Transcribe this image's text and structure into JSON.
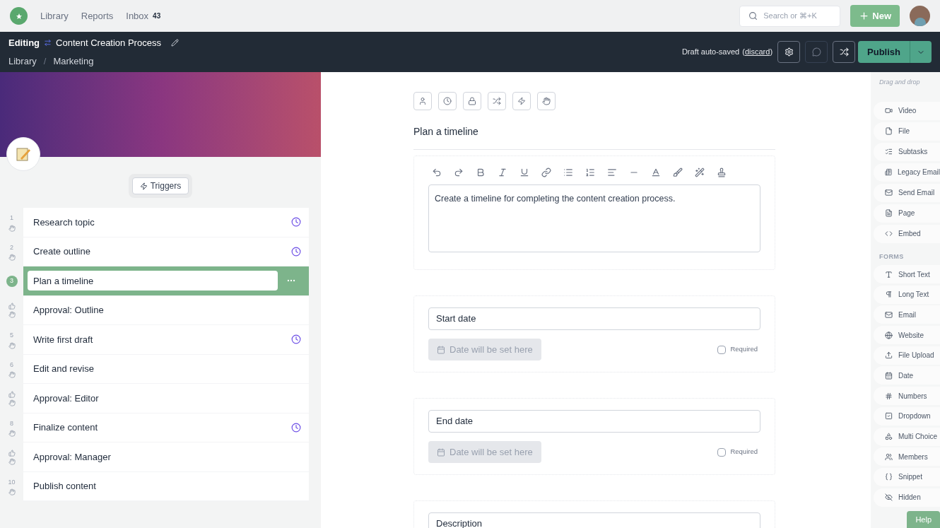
{
  "nav": {
    "links": [
      "Library",
      "Reports",
      "Inbox"
    ],
    "inbox_count": "43",
    "search": {
      "placeholder": "Search or ⌘+K"
    },
    "new_button": "New"
  },
  "header": {
    "mode": "Editing",
    "title": "Content Creation Process",
    "breadcrumb": [
      "Library",
      "Marketing"
    ],
    "breadcrumb_separator": "/",
    "draft_status": "Draft auto-saved",
    "discard_open": "(",
    "discard": "discard",
    "discard_close": ")",
    "publish": "Publish"
  },
  "triggers": "Triggers",
  "steps": [
    {
      "marker": "1",
      "kind": "task",
      "title": "Research topic",
      "timed": true,
      "selected": false
    },
    {
      "marker": "2",
      "kind": "task",
      "title": "Create outline",
      "timed": true,
      "selected": false
    },
    {
      "marker": "3",
      "kind": "task",
      "title": "Plan a timeline",
      "timed": false,
      "selected": true
    },
    {
      "kind": "approval",
      "title": "Approval: Outline",
      "timed": false,
      "selected": false
    },
    {
      "marker": "5",
      "kind": "task",
      "title": "Write first draft",
      "timed": true,
      "selected": false
    },
    {
      "marker": "6",
      "kind": "task",
      "title": "Edit and revise",
      "timed": false,
      "selected": false
    },
    {
      "kind": "approval",
      "title": "Approval: Editor",
      "timed": false,
      "selected": false
    },
    {
      "marker": "8",
      "kind": "task",
      "title": "Finalize content",
      "timed": true,
      "selected": false
    },
    {
      "kind": "approval",
      "title": "Approval: Manager",
      "timed": false,
      "selected": false
    },
    {
      "marker": "10",
      "kind": "task",
      "title": "Publish content",
      "timed": false,
      "selected": false
    }
  ],
  "editor": {
    "title": "Plan a timeline",
    "text": "Create a timeline for completing the content creation process.",
    "fields": [
      {
        "kind": "date",
        "label": "Start date",
        "button": "Date will be set here",
        "required_label": "Required",
        "required": false
      },
      {
        "kind": "date",
        "label": "End date",
        "button": "Date will be set here",
        "required_label": "Required",
        "required": false
      },
      {
        "kind": "text",
        "label": "Description"
      }
    ]
  },
  "widgets": {
    "hint": "Drag and drop",
    "content": [
      "Video",
      "File",
      "Subtasks",
      "Legacy Email",
      "Send Email",
      "Page",
      "Embed"
    ],
    "forms_heading": "FORMS",
    "forms": [
      "Short Text",
      "Long Text",
      "Email",
      "Website",
      "File Upload",
      "Date",
      "Numbers",
      "Dropdown",
      "Multi Choice",
      "Members",
      "Snippet",
      "Hidden"
    ]
  },
  "help": "Help"
}
